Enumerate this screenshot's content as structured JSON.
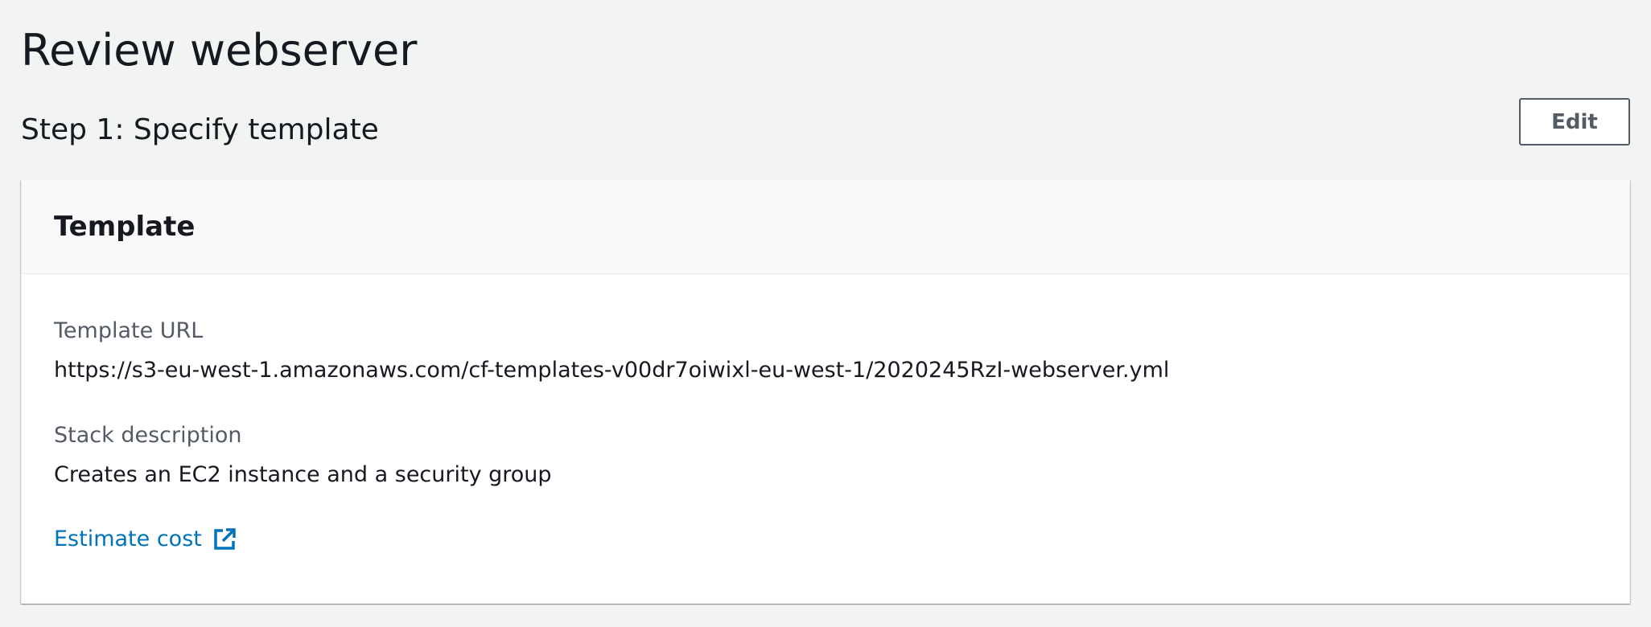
{
  "page": {
    "title": "Review webserver"
  },
  "step": {
    "title": "Step 1: Specify template",
    "edit_label": "Edit"
  },
  "template_card": {
    "header": "Template",
    "template_url_label": "Template URL",
    "template_url_value": "https://s3-eu-west-1.amazonaws.com/cf-templates-v00dr7oiwixl-eu-west-1/2020245RzI-webserver.yml",
    "stack_description_label": "Stack description",
    "stack_description_value": "Creates an EC2 instance and a security group",
    "estimate_cost_label": "Estimate cost",
    "estimate_cost_icon": "external-link-icon"
  },
  "colors": {
    "background": "#f2f3f3",
    "link": "#0073bb",
    "label": "#545b64",
    "text": "#16191f"
  }
}
